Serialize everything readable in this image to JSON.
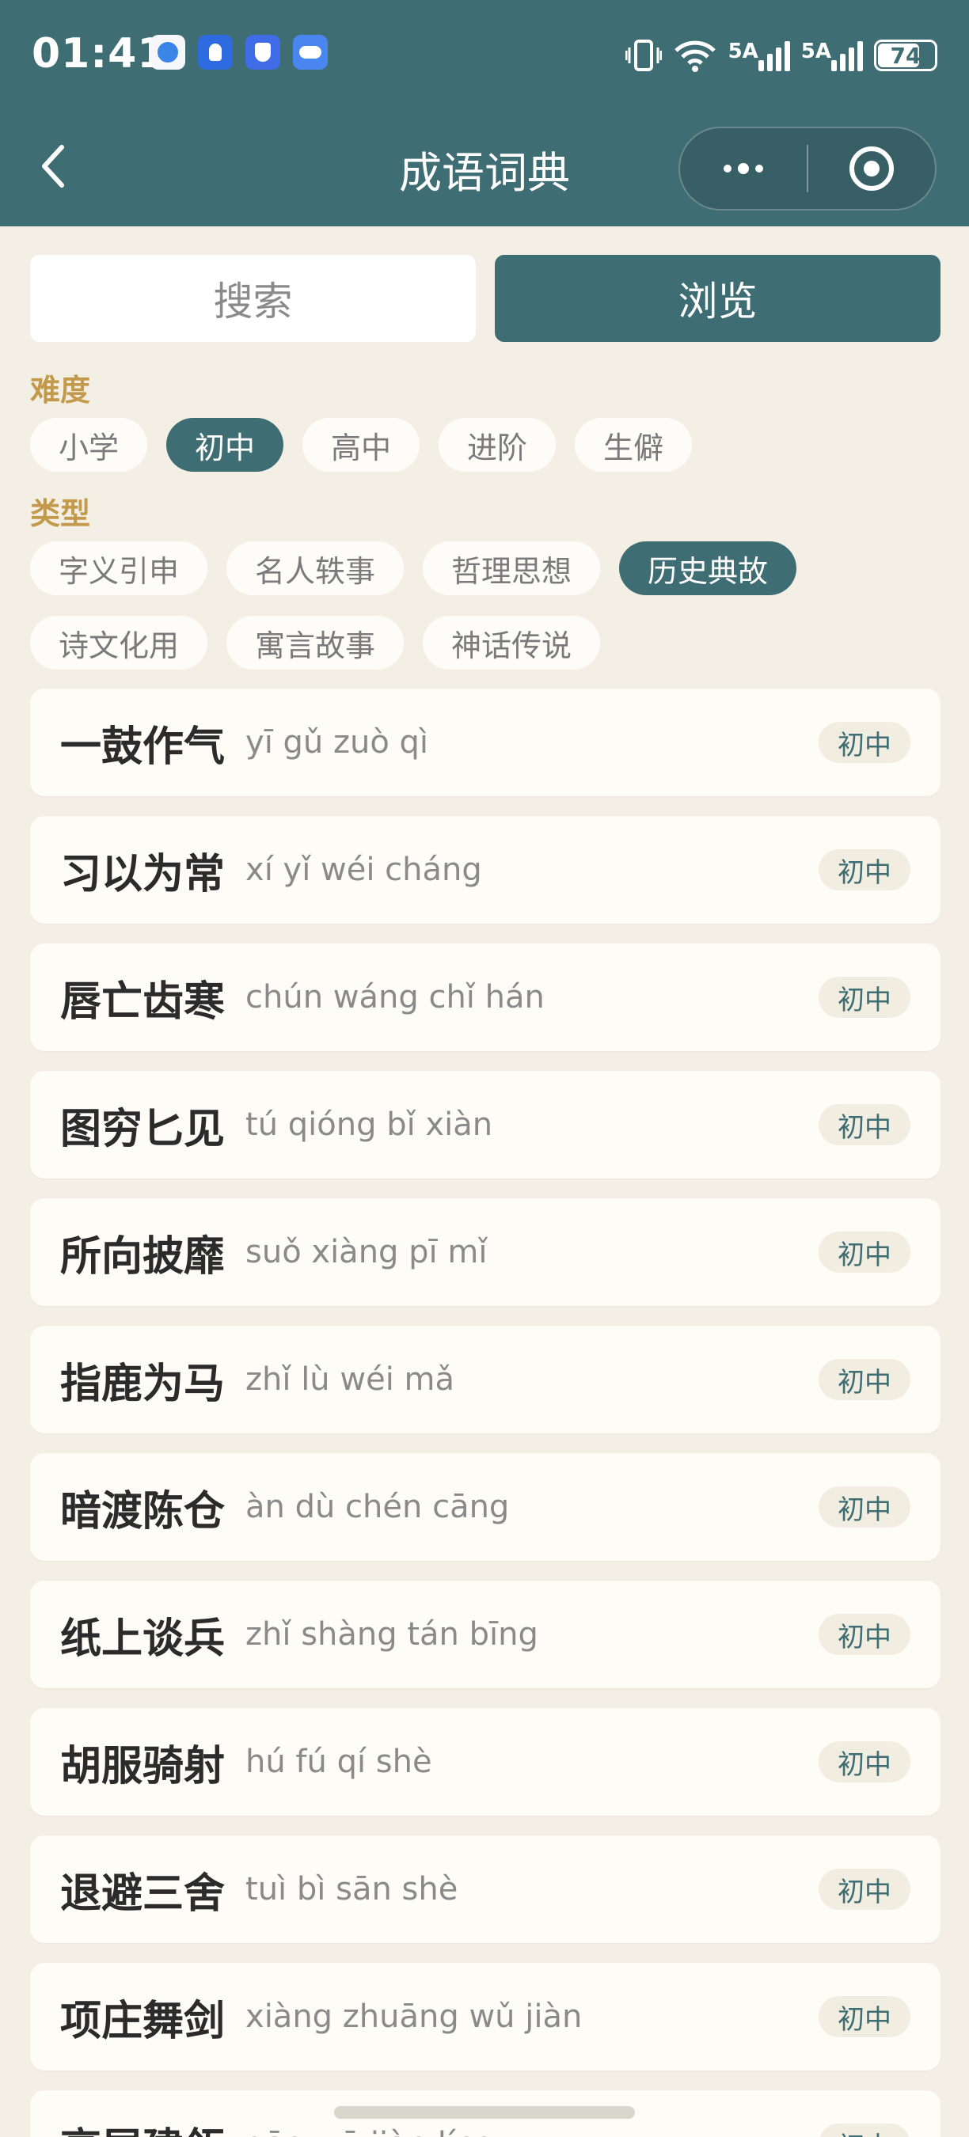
{
  "status_bar": {
    "time": "01:41",
    "signal1": "5A",
    "signal2": "5A",
    "battery": "74",
    "icons": [
      "browser-icon",
      "bulb-icon",
      "shield-icon",
      "cloud-icon",
      "vibrate-icon",
      "wifi-icon",
      "signal-icon",
      "battery-icon"
    ]
  },
  "header": {
    "title": "成语词典",
    "back_icon": "chevron-left-icon",
    "more_icon": "more-dots-icon",
    "close_icon": "target-icon"
  },
  "tabs": [
    {
      "label": "搜索",
      "active": false
    },
    {
      "label": "浏览",
      "active": true
    }
  ],
  "filters": {
    "difficulty_label": "难度",
    "difficulty": [
      "小学",
      "初中",
      "高中",
      "进阶",
      "生僻"
    ],
    "difficulty_selected": "初中",
    "type_label": "类型",
    "types": [
      "字义引申",
      "名人轶事",
      "哲理思想",
      "历史典故",
      "诗文化用",
      "寓言故事",
      "神话传说"
    ],
    "type_selected": "历史典故"
  },
  "idioms": [
    {
      "word": "一鼓作气",
      "pinyin": "yī gǔ zuò qì",
      "level": "初中"
    },
    {
      "word": "习以为常",
      "pinyin": "xí yǐ wéi cháng",
      "level": "初中"
    },
    {
      "word": "唇亡齿寒",
      "pinyin": "chún wáng chǐ hán",
      "level": "初中"
    },
    {
      "word": "图穷匕见",
      "pinyin": "tú qióng bǐ xiàn",
      "level": "初中"
    },
    {
      "word": "所向披靡",
      "pinyin": "suǒ xiàng pī mǐ",
      "level": "初中"
    },
    {
      "word": "指鹿为马",
      "pinyin": "zhǐ lù wéi mǎ",
      "level": "初中"
    },
    {
      "word": "暗渡陈仓",
      "pinyin": "àn dù chén cāng",
      "level": "初中"
    },
    {
      "word": "纸上谈兵",
      "pinyin": "zhǐ shàng tán bīng",
      "level": "初中"
    },
    {
      "word": "胡服骑射",
      "pinyin": "hú fú qí shè",
      "level": "初中"
    },
    {
      "word": "退避三舍",
      "pinyin": "tuì bì sān shè",
      "level": "初中"
    },
    {
      "word": "项庄舞剑",
      "pinyin": "xiàng zhuāng wǔ jiàn",
      "level": "初中"
    },
    {
      "word": "高屋建瓴",
      "pinyin": "gāo wū jiàn líng",
      "level": "初中"
    }
  ],
  "colors": {
    "primary": "#3f6d74",
    "background": "#f3efe4",
    "accent_label": "#c39a4c",
    "card": "#fdfcf7"
  }
}
